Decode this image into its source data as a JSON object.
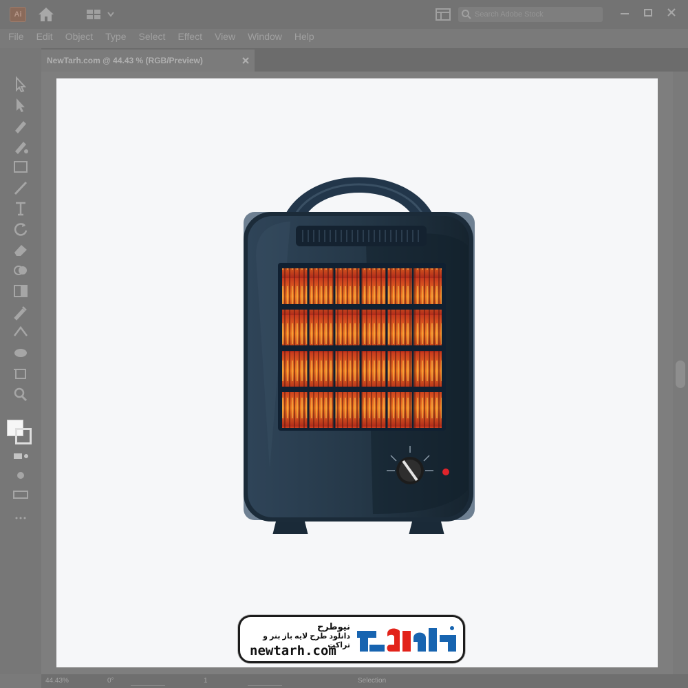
{
  "app": {
    "logo_text": "Ai",
    "search": {
      "placeholder": "Search Adobe Stock"
    }
  },
  "menu": [
    "File",
    "Edit",
    "Object",
    "Type",
    "Select",
    "Effect",
    "View",
    "Window",
    "Help"
  ],
  "document": {
    "tab_label": "NewTarh.com @ 44.43 % (RGB/Preview)"
  },
  "status": {
    "zoom": "44.43%",
    "rotation": "0°",
    "page": "1",
    "tool": "Selection"
  },
  "watermark": {
    "title": "نیوطرح",
    "tagline": "دانلود طرح لایه باز بنر و تراکت",
    "domain": "newtarh.com",
    "logo": "نیوطرح"
  },
  "colors": {
    "heater_body": "#27394a",
    "heater_dark": "#132230",
    "heater_back": "#6e8092",
    "element_orange": "#e8611e",
    "element_red": "#b8301f",
    "element_yellow": "#f2c14a",
    "indicator_red": "#e0242b",
    "logo_red": "#e2231a",
    "logo_blue": "#1764b0"
  },
  "icons": {
    "home": "home-icon",
    "workspace": "workspace-switcher-icon",
    "search": "search-icon",
    "close": "close-icon"
  }
}
